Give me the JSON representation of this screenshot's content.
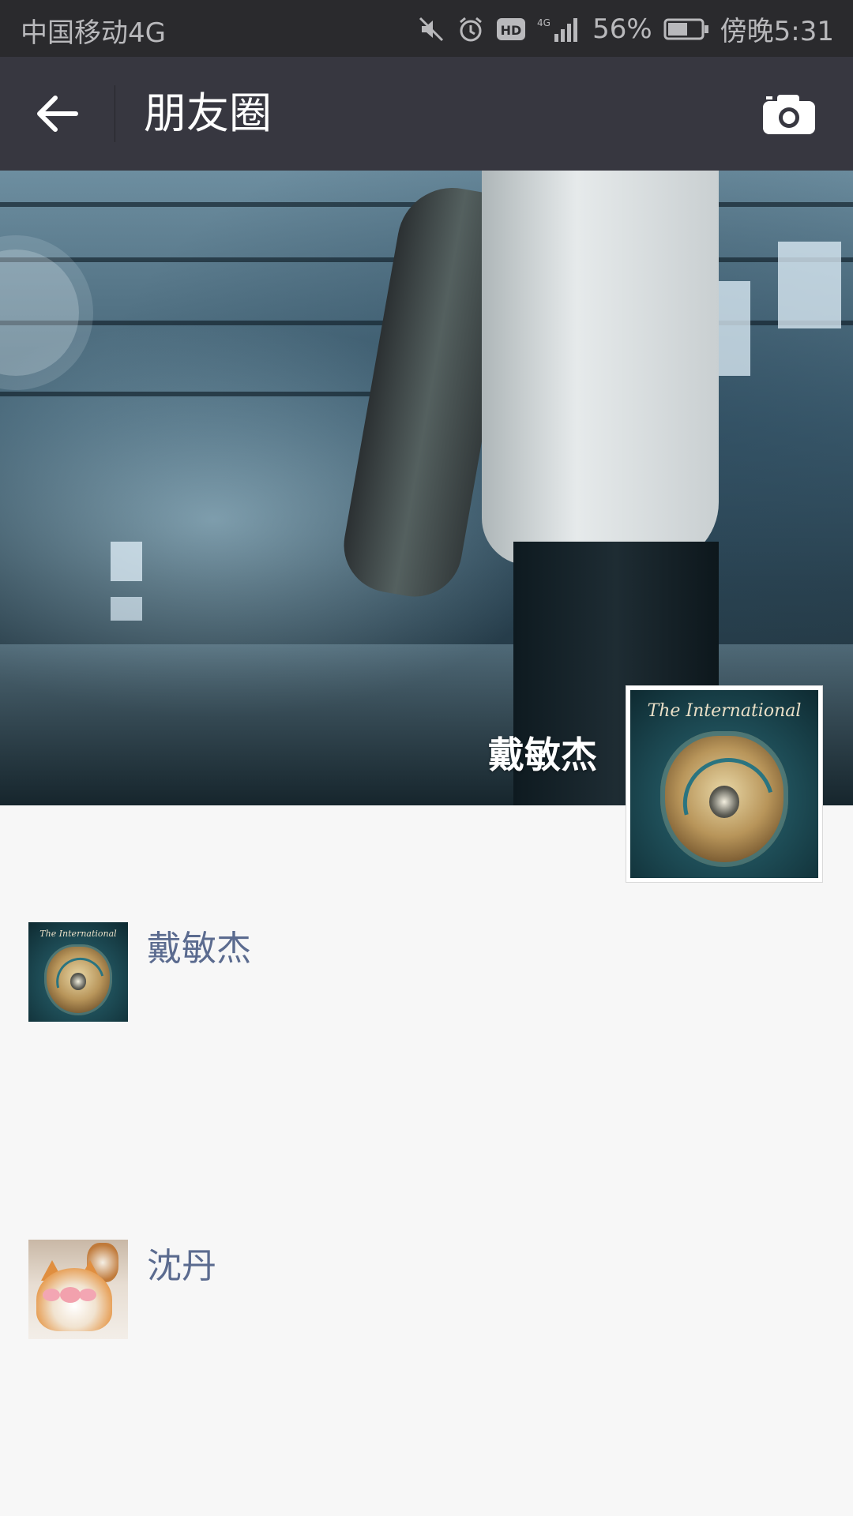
{
  "status_bar": {
    "carrier": "中国移动4G",
    "network": "4G",
    "battery": "56%",
    "time": "傍晚5:31",
    "icons": [
      "mute-icon",
      "alarm-icon",
      "hd-icon",
      "signal-icon",
      "battery-icon"
    ]
  },
  "app_bar": {
    "title": "朋友圈",
    "back_icon": "arrow-left-icon",
    "camera_icon": "camera-icon"
  },
  "cover": {
    "user_name": "戴敏杰",
    "avatar_caption": "The International"
  },
  "feed": [
    {
      "name": "戴敏杰",
      "avatar_caption": "The International"
    },
    {
      "name": "沈丹",
      "avatar": "cat"
    }
  ],
  "colors": {
    "status_bar_bg": "#2a2a2d",
    "app_bar_bg": "#373740",
    "page_bg": "#f7f7f7",
    "name_link": "#5b6b8f"
  }
}
